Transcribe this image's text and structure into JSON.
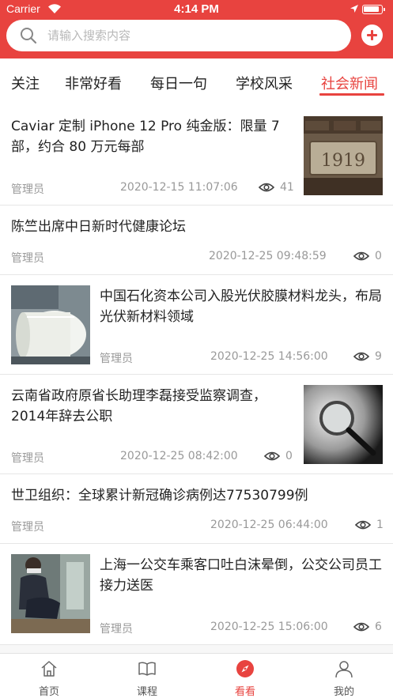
{
  "status_bar": {
    "carrier": "Carrier",
    "time": "4:14 PM"
  },
  "search": {
    "placeholder": "请输入搜索内容"
  },
  "accent_color": "#e8433f",
  "tabs": [
    {
      "label": "关注",
      "active": false
    },
    {
      "label": "非常好看",
      "active": false
    },
    {
      "label": "每日一句",
      "active": false
    },
    {
      "label": "学校风采",
      "active": false
    },
    {
      "label": "社会新闻",
      "active": true
    }
  ],
  "news": [
    {
      "title": "Caviar 定制 iPhone 12 Pro 纯金版：限量 7 部，约合 80 万元每部",
      "author": "管理员",
      "date": "2020-12-15 11:07:06",
      "views": "41",
      "image": "1919-stone-plaque",
      "image_text": "1919",
      "image_side": "right"
    },
    {
      "title": "陈竺出席中日新时代健康论坛",
      "author": "管理员",
      "date": "2020-12-25 09:48:59",
      "views": "0",
      "image": "",
      "image_side": "none"
    },
    {
      "title": "中国石化资本公司入股光伏胶膜材料龙头，布局光伏新材料领域",
      "author": "管理员",
      "date": "2020-12-25 14:56:00",
      "views": "9",
      "image": "film-roll-factory",
      "image_side": "left"
    },
    {
      "title": "云南省政府原省长助理李磊接受监察调查，2014年辞去公职",
      "author": "管理员",
      "date": "2020-12-25 08:42:00",
      "views": "0",
      "image": "magnifying-glass",
      "image_side": "right"
    },
    {
      "title": "世卫组织：全球累计新冠确诊病例达77530799例",
      "author": "管理员",
      "date": "2020-12-25 06:44:00",
      "views": "1",
      "image": "",
      "image_side": "none"
    },
    {
      "title": "上海一公交车乘客口吐白沫晕倒，公交公司员工接力送医",
      "author": "管理员",
      "date": "2020-12-25 15:06:00",
      "views": "6",
      "image": "bus-rescue",
      "image_side": "left"
    }
  ],
  "tabbar": [
    {
      "label": "首页",
      "icon": "home-icon",
      "active": false
    },
    {
      "label": "课程",
      "icon": "book-icon",
      "active": false
    },
    {
      "label": "看看",
      "icon": "compass-icon",
      "active": true
    },
    {
      "label": "我的",
      "icon": "user-icon",
      "active": false
    }
  ]
}
